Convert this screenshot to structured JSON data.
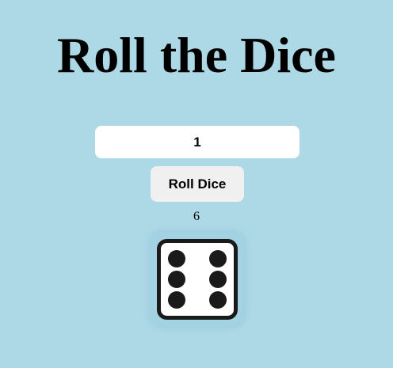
{
  "page": {
    "title": "Roll the Dice"
  },
  "controls": {
    "dice_count_value": "1",
    "roll_button_label": "Roll Dice"
  },
  "result": {
    "total": "6",
    "dice": [
      {
        "face": 6,
        "icon": "dice-six-icon"
      }
    ]
  },
  "colors": {
    "background": "#add8e6",
    "button_bg": "#f0f0f0",
    "input_bg": "#ffffff",
    "die_face": "#ffffff",
    "die_border": "#1a1a1a",
    "pip": "#1a1a1a"
  }
}
